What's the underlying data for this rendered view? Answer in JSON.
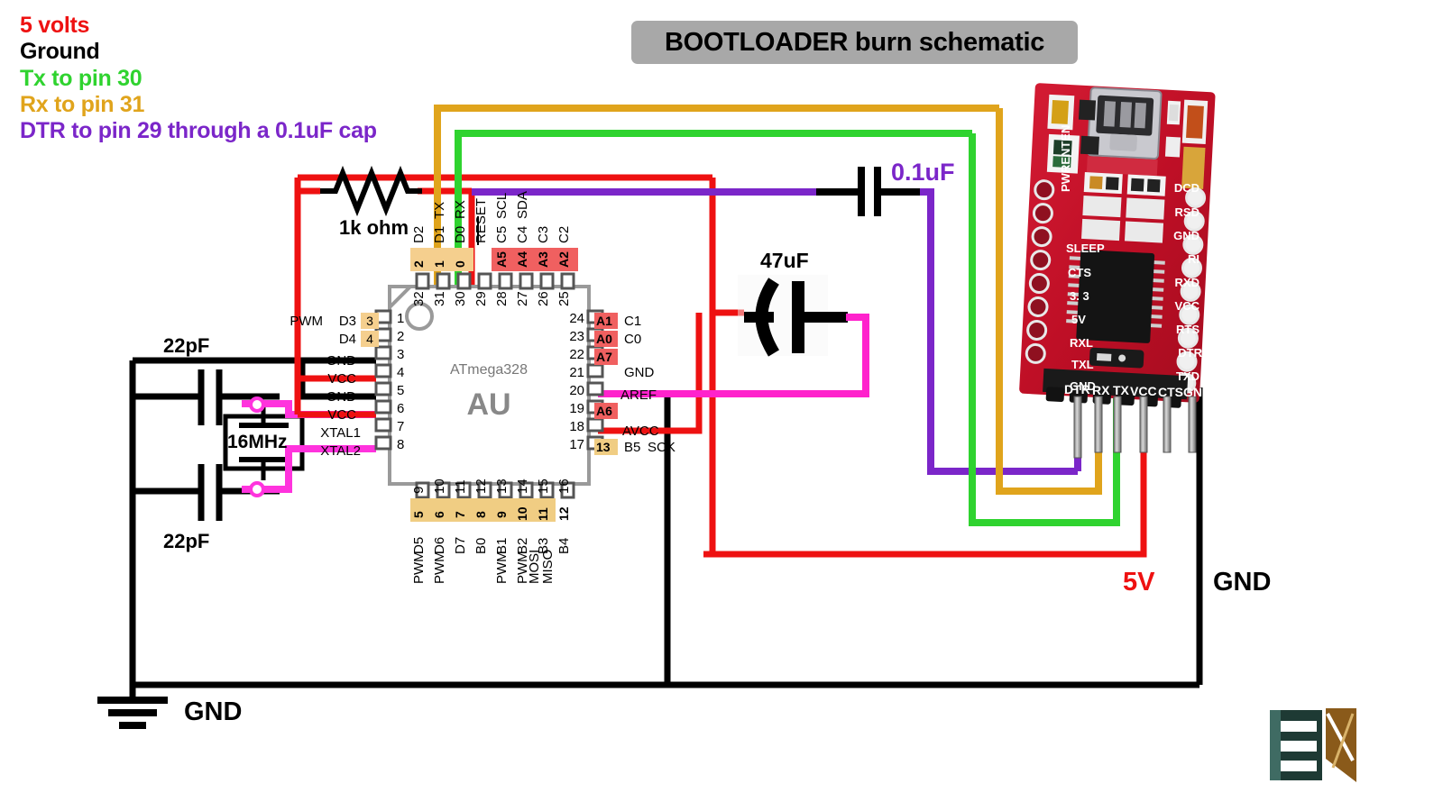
{
  "title": {
    "text": "BOOTLOADER burn schematic"
  },
  "legend": {
    "items": [
      {
        "label": "5 volts",
        "color": "#ee1111"
      },
      {
        "label": "Ground",
        "color": "#000000"
      },
      {
        "label": "Tx to pin 30",
        "color": "#2fd32f"
      },
      {
        "label": "Rx to pin 31",
        "color": "#e0a41c"
      },
      {
        "label": "DTR to pin 29 through a 0.1uF cap",
        "color": "#7b26c9"
      }
    ]
  },
  "colors": {
    "v5": "#ee1111",
    "ground": "#000000",
    "tx": "#2fd32f",
    "rx": "#e0a41c",
    "dtr": "#7b26c9",
    "xtal": "#ff33dd",
    "aref": "#ff22cc",
    "pin_orange": "#f5cf8e",
    "pin_red": "#f06060",
    "chip_body": "#ffffff",
    "chip_outline": "#9a9a9a",
    "title_bg": "#a8a8a8",
    "board_red": "#c8102e"
  },
  "chip": {
    "name": "ATmega328",
    "suffix": "AU",
    "left_pins": [
      {
        "num": "1",
        "alt": "3",
        "alt_color": "orange",
        "names": [
          "PWM",
          "D3"
        ]
      },
      {
        "num": "2",
        "alt": "4",
        "alt_color": "orange",
        "names": [
          "D4"
        ]
      },
      {
        "num": "3",
        "alt": "",
        "alt_color": "",
        "names": [
          "GND"
        ]
      },
      {
        "num": "4",
        "alt": "",
        "alt_color": "",
        "names": [
          "VCC"
        ]
      },
      {
        "num": "5",
        "alt": "",
        "alt_color": "",
        "names": [
          "GND"
        ]
      },
      {
        "num": "6",
        "alt": "",
        "alt_color": "",
        "names": [
          "VCC"
        ]
      },
      {
        "num": "7",
        "alt": "",
        "alt_color": "",
        "names": [
          "XTAL1"
        ]
      },
      {
        "num": "8",
        "alt": "",
        "alt_color": "",
        "names": [
          "XTAL2"
        ]
      }
    ],
    "right_pins": [
      {
        "num": "24",
        "alt": "A1",
        "alt_color": "red",
        "names": [
          "C1"
        ]
      },
      {
        "num": "23",
        "alt": "A0",
        "alt_color": "red",
        "names": [
          "C0"
        ]
      },
      {
        "num": "22",
        "alt": "A7",
        "alt_color": "red",
        "names": [
          ""
        ]
      },
      {
        "num": "21",
        "alt": "",
        "alt_color": "",
        "names": [
          "GND"
        ]
      },
      {
        "num": "20",
        "alt": "",
        "alt_color": "",
        "names": [
          "AREF"
        ]
      },
      {
        "num": "19",
        "alt": "A6",
        "alt_color": "red",
        "names": [
          ""
        ]
      },
      {
        "num": "18",
        "alt": "",
        "alt_color": "",
        "names": [
          "AVCC"
        ]
      },
      {
        "num": "17",
        "alt": "13",
        "alt_color": "orange",
        "names": [
          "B5",
          "SCK"
        ]
      }
    ],
    "top_pins": [
      {
        "num": "32",
        "alt": "2",
        "alt_color": "orange",
        "name": "D2",
        "name2": ""
      },
      {
        "num": "31",
        "alt": "1",
        "alt_color": "orange",
        "name": "D1",
        "name2": "TX"
      },
      {
        "num": "30",
        "alt": "0",
        "alt_color": "orange",
        "name": "D0",
        "name2": "RX"
      },
      {
        "num": "29",
        "alt": "",
        "alt_color": "",
        "name": "RESET",
        "name2": ""
      },
      {
        "num": "28",
        "alt": "A5",
        "alt_color": "red",
        "name": "C5",
        "name2": "SCL"
      },
      {
        "num": "27",
        "alt": "A4",
        "alt_color": "red",
        "name": "C4",
        "name2": "SDA"
      },
      {
        "num": "26",
        "alt": "A3",
        "alt_color": "red",
        "name": "C3",
        "name2": ""
      },
      {
        "num": "25",
        "alt": "A2",
        "alt_color": "red",
        "name": "C2",
        "name2": ""
      }
    ],
    "bottom_pins": [
      {
        "num": "9",
        "alt": "5",
        "alt_color": "orange",
        "name": "D5",
        "extra": "PWM"
      },
      {
        "num": "10",
        "alt": "6",
        "alt_color": "orange",
        "name": "D6",
        "extra": "PWM"
      },
      {
        "num": "11",
        "alt": "7",
        "alt_color": "orange",
        "name": "D7",
        "extra": ""
      },
      {
        "num": "12",
        "alt": "8",
        "alt_color": "orange",
        "name": "B0",
        "extra": ""
      },
      {
        "num": "13",
        "alt": "9",
        "alt_color": "orange",
        "name": "B1",
        "extra": "PWM"
      },
      {
        "num": "14",
        "alt": "10",
        "alt_color": "orange",
        "name": "B2",
        "extra": "PWM"
      },
      {
        "num": "15",
        "alt": "11",
        "alt_color": "orange",
        "name": "B3",
        "extra": "MOSI"
      },
      {
        "num": "16",
        "alt": "12",
        "alt_color": "orange",
        "name": "B4",
        "extra": "MISO"
      }
    ]
  },
  "components": {
    "resistor": {
      "label": "1k ohm"
    },
    "cap_22pf_top": {
      "label": "22pF"
    },
    "cap_22pf_bottom": {
      "label": "22pF"
    },
    "crystal": {
      "label": "16MHz"
    },
    "cap_47uf": {
      "label": "47uF"
    },
    "cap_01uf": {
      "label": "0.1uF"
    }
  },
  "annotations": {
    "gnd_symbol": "GND",
    "rail_5v": "5V",
    "rail_gnd": "GND"
  },
  "ftdi": {
    "left_labels": [
      "PWRENTEN",
      "SLEEP",
      "CTS",
      "3. 3",
      "5V",
      "RXL",
      "TXL",
      "GND"
    ],
    "right_labels": [
      "DCD",
      "RSD",
      "GND",
      "RI",
      "RXD",
      "VCC",
      "RTS",
      "DTR",
      "TXD"
    ],
    "header_labels": [
      "DTR",
      "RX",
      "TX",
      "VCC",
      "CTS",
      "GND"
    ]
  }
}
